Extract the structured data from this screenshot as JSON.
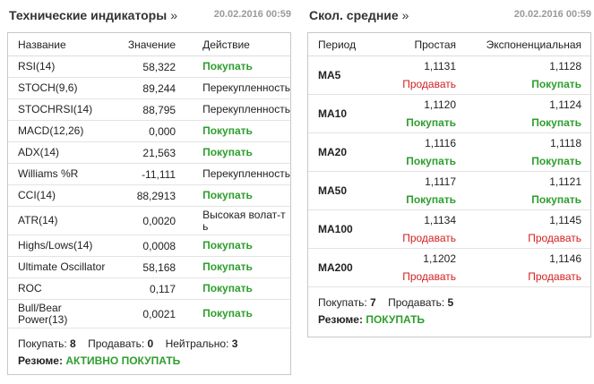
{
  "technical": {
    "title": "Технические индикаторы",
    "arrow": "»",
    "date": "20.02.2016 00:59",
    "columns": {
      "name": "Название",
      "value": "Значение",
      "action": "Действие"
    },
    "rows": [
      {
        "name": "RSI(14)",
        "value": "58,322",
        "action": "Покупать",
        "color": "#2e9e2e"
      },
      {
        "name": "STOCH(9,6)",
        "value": "89,244",
        "action": "Перекупленность",
        "color": "#222222"
      },
      {
        "name": "STOCHRSI(14)",
        "value": "88,795",
        "action": "Перекупленность",
        "color": "#222222"
      },
      {
        "name": "MACD(12,26)",
        "value": "0,000",
        "action": "Покупать",
        "color": "#2e9e2e"
      },
      {
        "name": "ADX(14)",
        "value": "21,563",
        "action": "Покупать",
        "color": "#2e9e2e"
      },
      {
        "name": "Williams %R",
        "value": "-11,111",
        "action": "Перекупленность",
        "color": "#222222"
      },
      {
        "name": "CCI(14)",
        "value": "88,2913",
        "action": "Покупать",
        "color": "#2e9e2e"
      },
      {
        "name": "ATR(14)",
        "value": "0,0020",
        "action": "Высокая волат-ть",
        "color": "#222222"
      },
      {
        "name": "Highs/Lows(14)",
        "value": "0,0008",
        "action": "Покупать",
        "color": "#2e9e2e"
      },
      {
        "name": "Ultimate Oscillator",
        "value": "58,168",
        "action": "Покупать",
        "color": "#2e9e2e"
      },
      {
        "name": "ROC",
        "value": "0,117",
        "action": "Покупать",
        "color": "#2e9e2e"
      },
      {
        "name": "Bull/Bear Power(13)",
        "value": "0,0021",
        "action": "Покупать",
        "color": "#2e9e2e"
      }
    ],
    "summary": {
      "buy_label": "Покупать:",
      "buy_count": "8",
      "sell_label": "Продавать:",
      "sell_count": "0",
      "neutral_label": "Нейтрально:",
      "neutral_count": "3",
      "resume_label": "Резюме:",
      "resume_value": "АКТИВНО ПОКУПАТЬ"
    }
  },
  "moving_averages": {
    "title": "Скол. средние",
    "arrow": "»",
    "date": "20.02.2016 00:59",
    "columns": {
      "period": "Период",
      "simple": "Простая",
      "exponential": "Экспоненциальная"
    },
    "rows": [
      {
        "period": "MA5",
        "simple_value": "1,1131",
        "simple_action": "Продавать",
        "simple_color": "#d21f1f",
        "exp_value": "1,1128",
        "exp_action": "Покупать",
        "exp_color": "#2e9e2e"
      },
      {
        "period": "MA10",
        "simple_value": "1,1120",
        "simple_action": "Покупать",
        "simple_color": "#2e9e2e",
        "exp_value": "1,1124",
        "exp_action": "Покупать",
        "exp_color": "#2e9e2e"
      },
      {
        "period": "MA20",
        "simple_value": "1,1116",
        "simple_action": "Покупать",
        "simple_color": "#2e9e2e",
        "exp_value": "1,1118",
        "exp_action": "Покупать",
        "exp_color": "#2e9e2e"
      },
      {
        "period": "MA50",
        "simple_value": "1,1117",
        "simple_action": "Покупать",
        "simple_color": "#2e9e2e",
        "exp_value": "1,1121",
        "exp_action": "Покупать",
        "exp_color": "#2e9e2e"
      },
      {
        "period": "MA100",
        "simple_value": "1,1134",
        "simple_action": "Продавать",
        "simple_color": "#d21f1f",
        "exp_value": "1,1145",
        "exp_action": "Продавать",
        "exp_color": "#d21f1f"
      },
      {
        "period": "MA200",
        "simple_value": "1,1202",
        "simple_action": "Продавать",
        "simple_color": "#d21f1f",
        "exp_value": "1,1146",
        "exp_action": "Продавать",
        "exp_color": "#d21f1f"
      }
    ],
    "summary": {
      "buy_label": "Покупать:",
      "buy_count": "7",
      "sell_label": "Продавать:",
      "sell_count": "5",
      "resume_label": "Резюме:",
      "resume_value": "ПОКУПАТЬ"
    }
  }
}
